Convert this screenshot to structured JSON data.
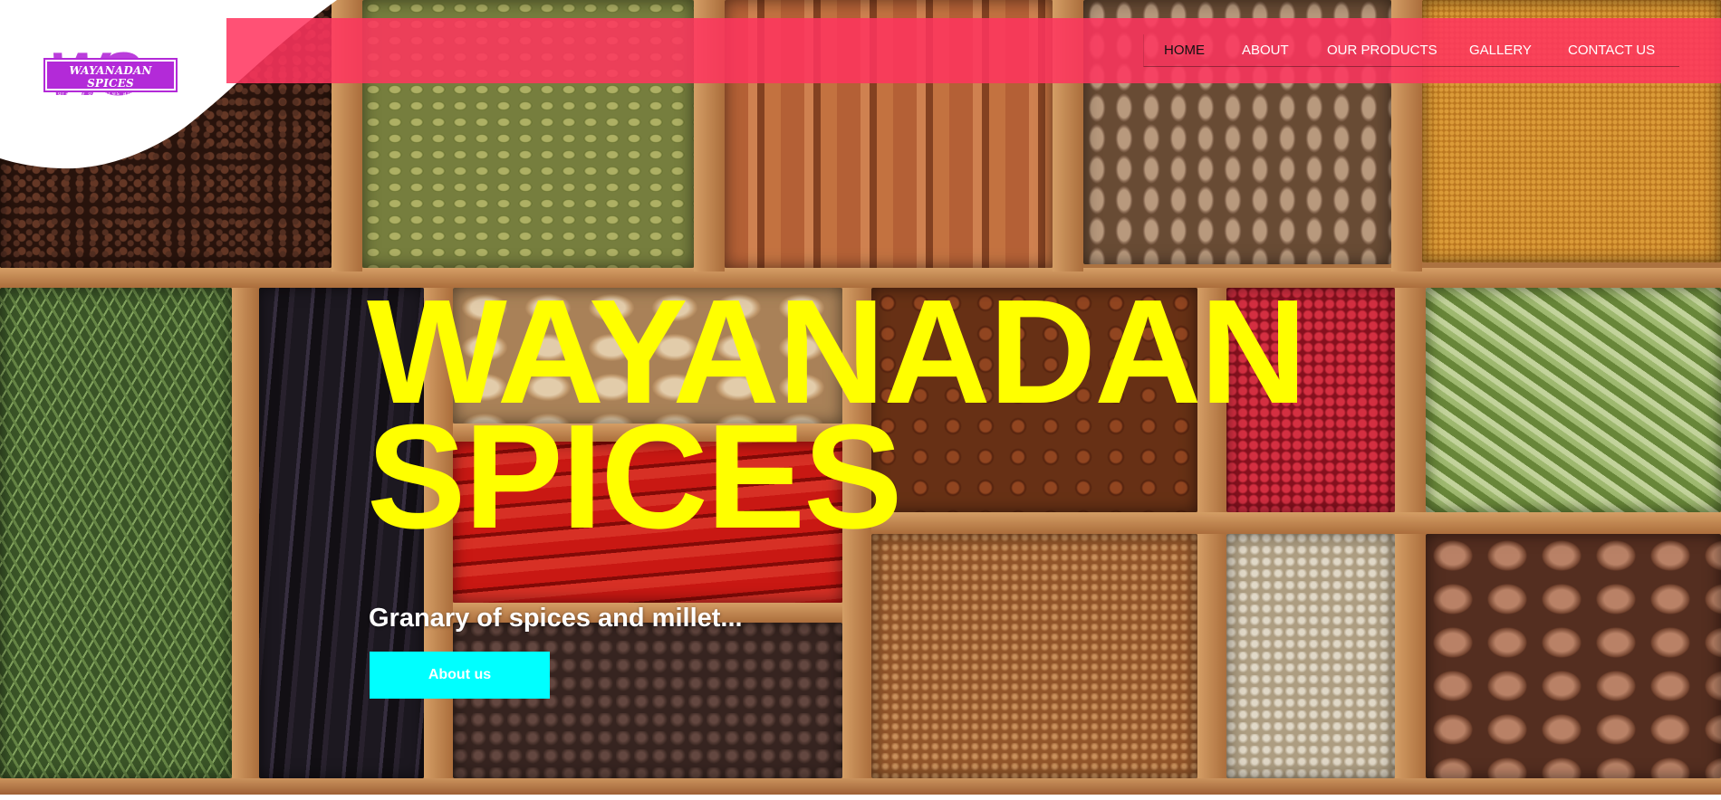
{
  "brand": {
    "logo_mark": "WS",
    "logo_name": "WAYANADAN SPICES",
    "logo_tagline": "granary of spices and millets",
    "accent_color": "#b32ad8"
  },
  "nav": {
    "band_color": "#ff345e",
    "items": [
      {
        "label": "HOME",
        "active": true
      },
      {
        "label": "ABOUT",
        "active": false
      },
      {
        "label": "OUR PRODUCTS",
        "active": false
      },
      {
        "label": "GALLERY",
        "active": false
      },
      {
        "label": "CONTACT US",
        "active": false
      }
    ]
  },
  "hero": {
    "title_line1": "WAYANADAN",
    "title_line2": "SPICES",
    "title_color": "#ffff00",
    "subtitle": "Granary of spices and millet...",
    "cta_label": "About us",
    "cta_color": "#00ffff",
    "background": "spice-box-photo"
  }
}
